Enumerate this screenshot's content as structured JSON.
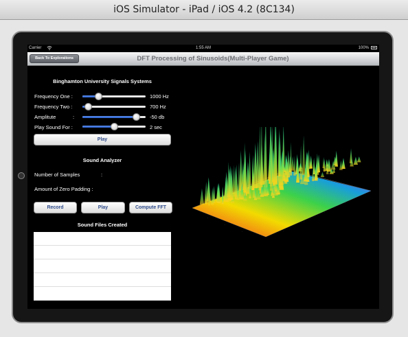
{
  "window": {
    "title": "iOS Simulator - iPad / iOS 4.2 (8C134)"
  },
  "status_bar": {
    "carrier": "Carrier",
    "time": "1:55 AM",
    "battery": "100%"
  },
  "nav": {
    "back_label": "Back To Explorations",
    "title": "DFT Processing of Sinusoids(Multi-Player Game)"
  },
  "signals": {
    "heading": "Binghamton University Signals Systems",
    "sliders": [
      {
        "label": "Frequency One :",
        "value": "1000 Hz",
        "level": 0.25
      },
      {
        "label": "Frequency Two :",
        "value": "700 Hz",
        "level": 0.09
      },
      {
        "label": "Amplitute",
        "colon": ":",
        "value": "-50 db",
        "level": 0.85
      },
      {
        "label": "Play Sound For :",
        "value": "2 sec",
        "level": 0.5
      }
    ],
    "play_label": "Play"
  },
  "analyzer": {
    "heading": "Sound Analyzer",
    "samples_label": "Number of Samples",
    "samples_colon": ":",
    "zero_padding_label": "Amount of Zero Padding :",
    "record_label": "Record",
    "play_label": "Play",
    "fft_label": "Compute FFT"
  },
  "files": {
    "heading": "Sound Files Created",
    "rows": [
      "",
      "",
      "",
      "",
      ""
    ]
  },
  "plot": {
    "type": "3d-spectrogram-surface",
    "colormap": [
      "#ff2020",
      "#ffee00",
      "#39d94f",
      "#1aa6e6",
      "#8a35ff"
    ]
  }
}
